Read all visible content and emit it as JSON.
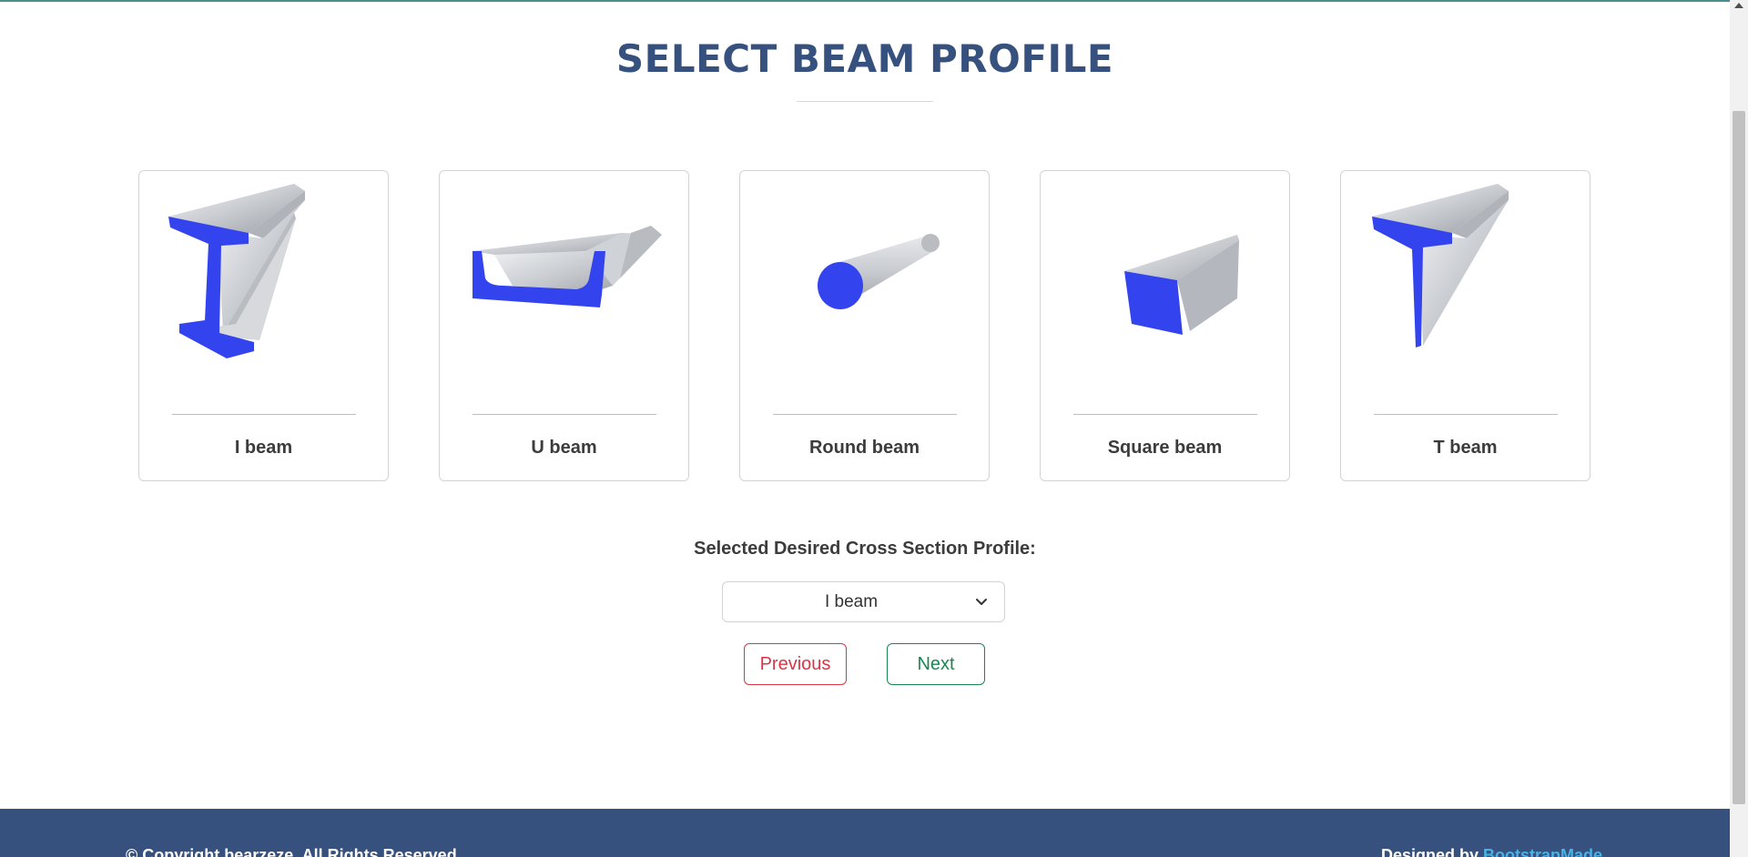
{
  "header": {
    "title": "SELECT BEAM PROFILE"
  },
  "profiles": [
    {
      "label": "I beam",
      "icon": "i-beam-icon"
    },
    {
      "label": "U beam",
      "icon": "u-beam-icon"
    },
    {
      "label": "Round beam",
      "icon": "round-beam-icon"
    },
    {
      "label": "Square beam",
      "icon": "square-beam-icon"
    },
    {
      "label": "T beam",
      "icon": "t-beam-icon"
    }
  ],
  "selection": {
    "label": "Selected Desired Cross Section Profile:",
    "selected_value": "I beam"
  },
  "buttons": {
    "previous": "Previous",
    "next": "Next"
  },
  "footer": {
    "copyright": "© Copyright bearzeze. All Rights Reserved",
    "designed_prefix": "Designed by ",
    "designed_link": "BootstrapMade"
  },
  "colors": {
    "title": "#37517e",
    "profile_face": "#3344ee",
    "previous": "#dc3545",
    "next": "#198754",
    "footer_bg": "#37517e",
    "link": "#47b2e4"
  }
}
